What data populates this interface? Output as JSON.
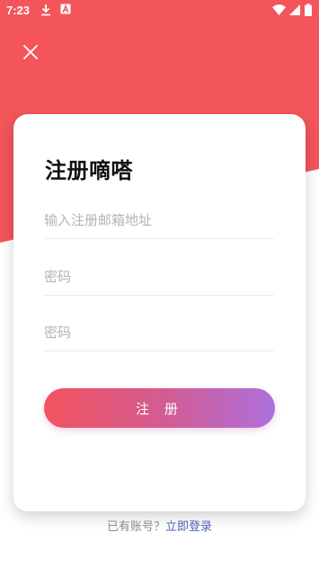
{
  "status_bar": {
    "time": "7:23",
    "left_icons": [
      "download-icon",
      "text-a-icon"
    ],
    "right_icons": [
      "wifi-icon",
      "signal-icon",
      "battery-icon"
    ]
  },
  "colors": {
    "header_red": "#f3555a",
    "button_gradient_start": "#f2535e",
    "button_gradient_end": "#ad70de",
    "link_blue": "#4a63b8"
  },
  "form": {
    "title": "注册嘀嗒",
    "email_placeholder": "输入注册邮箱地址",
    "password_placeholder": "密码",
    "confirm_password_placeholder": "密码",
    "register_label": "注 册"
  },
  "footer": {
    "hint": "已有账号？",
    "login_link": "立即登录"
  }
}
